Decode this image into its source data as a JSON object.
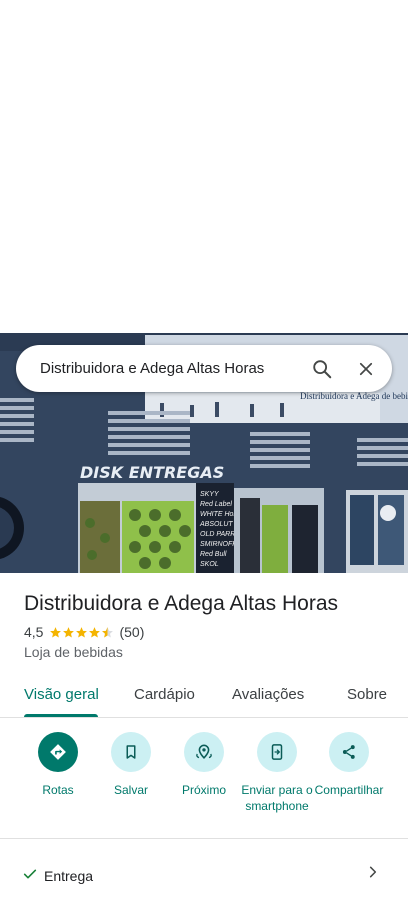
{
  "search": {
    "query": "Distribuidora e Adega Altas Horas",
    "search_icon": "search-icon",
    "close_icon": "close-icon"
  },
  "photo": {
    "storefront_text": "DISK ENTREGAS",
    "window_text": [
      "SKYY",
      "Red Label",
      "WHITE Horse",
      "ABSOLUT",
      "OLD PARR",
      "SMIRNOFF",
      "Red Bull",
      "SKOL"
    ],
    "banner_text": "Distribuidora e Adega de bebidas",
    "colors": {
      "wall": "#33455f",
      "sky": "#cfd8e3"
    }
  },
  "place": {
    "name": "Distribuidora e Adega Altas Horas",
    "rating": "4,5",
    "rating_value": 4.5,
    "reviews": "(50)",
    "category": "Loja de bebidas",
    "star_color": "#f4b400"
  },
  "tabs": [
    {
      "label": "Visão geral",
      "active": true
    },
    {
      "label": "Cardápio",
      "active": false
    },
    {
      "label": "Avaliações",
      "active": false
    },
    {
      "label": "Sobre",
      "active": false
    }
  ],
  "actions": [
    {
      "label": "Rotas",
      "icon": "directions-icon"
    },
    {
      "label": "Salvar",
      "icon": "bookmark-icon"
    },
    {
      "label": "Próximo",
      "icon": "nearby-icon"
    },
    {
      "label": "Enviar para o smartphone",
      "icon": "send-to-phone-icon"
    },
    {
      "label": "Compartilhar",
      "icon": "share-icon"
    }
  ],
  "delivery": {
    "label": "Entrega",
    "check_icon": "check-icon",
    "chevron_icon": "chevron-right-icon"
  },
  "accent_color": "#00796b"
}
